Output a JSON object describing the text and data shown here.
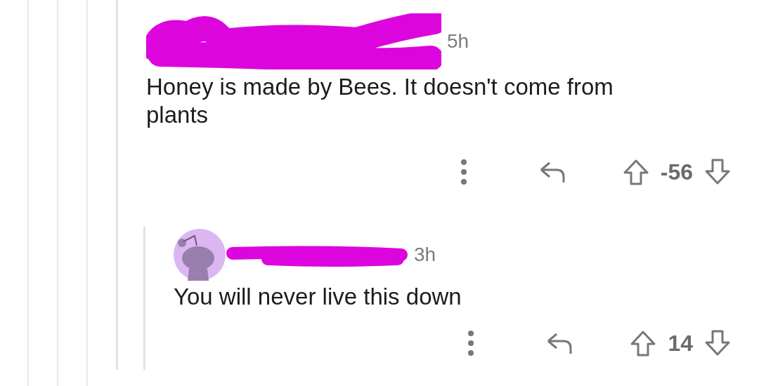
{
  "comments": [
    {
      "redacted": true,
      "avatar": false,
      "time": "5h",
      "body": "Honey is made by Bees. It doesn't come from plants",
      "score": "-56",
      "children": [
        {
          "redacted": true,
          "avatar": true,
          "time": "3h",
          "body": "You will never live this down",
          "score": "14"
        }
      ]
    }
  ]
}
